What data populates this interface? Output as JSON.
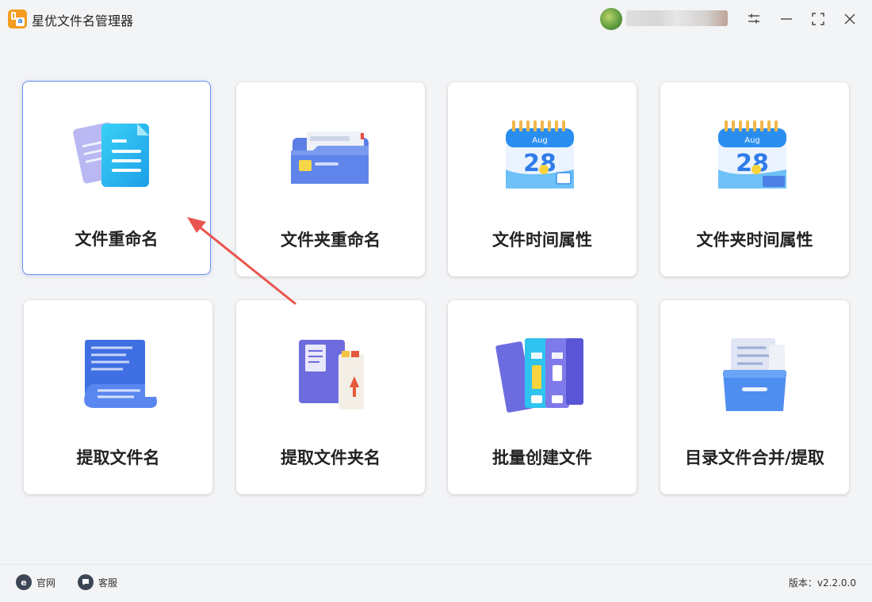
{
  "app": {
    "title": "星优文件名管理器"
  },
  "cards": [
    {
      "label": "文件重命名"
    },
    {
      "label": "文件夹重命名"
    },
    {
      "label": "文件时间属性"
    },
    {
      "label": "文件夹时间属性"
    },
    {
      "label": "提取文件名"
    },
    {
      "label": "提取文件夹名"
    },
    {
      "label": "批量创建文件"
    },
    {
      "label": "目录文件合并/提取"
    }
  ],
  "calendar": {
    "month": "Aug",
    "day": "28"
  },
  "footer": {
    "website_label": "官网",
    "support_label": "客服",
    "version_label": "版本：v2.2.0.0"
  },
  "colors": {
    "accent": "#6a8ef0",
    "arrow": "#e8554e",
    "logo": "#f39c1f"
  }
}
